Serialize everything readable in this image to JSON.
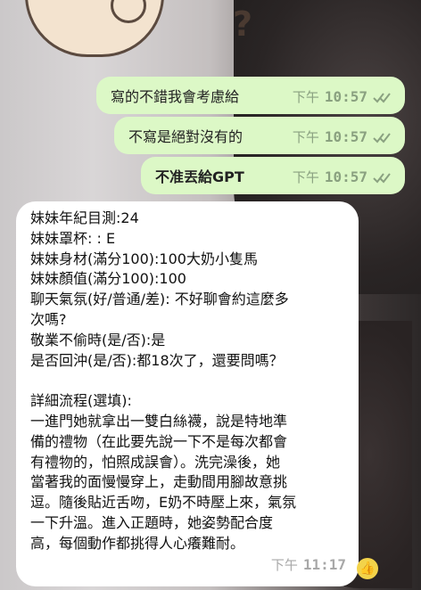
{
  "top_sticker": {
    "symbol": "?"
  },
  "outgoing_messages": [
    {
      "text": "寫的不錯我會考慮給",
      "time_prefix": "下午",
      "time": "10:57"
    },
    {
      "text": "不寫是絕對沒有的",
      "time_prefix": "下午",
      "time": "10:57"
    },
    {
      "text": "不准丟給GPT",
      "time_prefix": "下午",
      "time": "10:57"
    }
  ],
  "incoming_message": {
    "lines": [
      "妹妹年紀目測:24",
      "妹妹罩杯: : E",
      "妹妹身材(滿分100):100大奶小隻馬",
      "妹妹顏值(滿分100):100",
      "聊天氣氛(好/普通/差): 不好聊會約這麼多",
      "次嗎?",
      "敬業不偷時(是/否):是",
      "是否回沖(是/否):都18次了，還要問嗎？",
      "",
      "詳細流程(選填):",
      "一進門她就拿出一雙白絲襪，說是特地準",
      "備的禮物（在此要先說一下不是每次都會",
      "有禮物的，怕照成誤會）。洗完澡後，她",
      "當著我的面慢慢穿上，走動間用腳故意挑",
      "逗。隨後貼近舌吻，E奶不時壓上來，氣氛",
      "一下升溫。進入正題時，她姿勢配合度",
      "高，每個動作都挑得人心癢難耐。"
    ],
    "time_prefix": "下午",
    "time": "11:17",
    "reaction": "👍"
  },
  "icons": {
    "read_ticks": "double-check-icon",
    "reaction": "thumbs-up-icon"
  },
  "colors": {
    "outgoing_bubble": "#dcf8c6",
    "incoming_bubble": "#ffffff",
    "ticks": "#8aa180"
  }
}
